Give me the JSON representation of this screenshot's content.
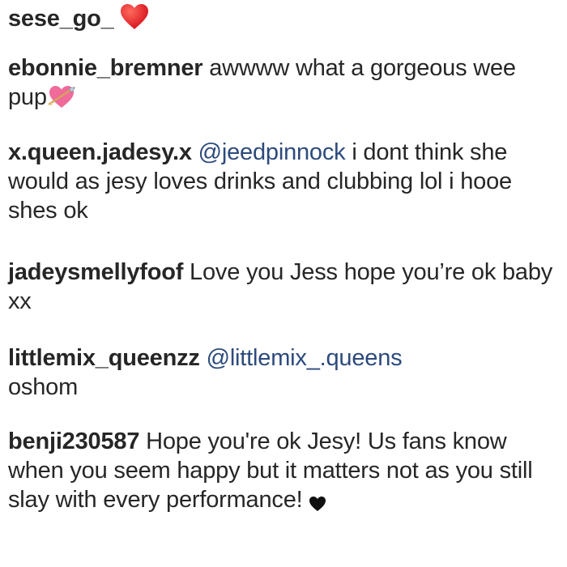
{
  "comments": [
    {
      "username": "sese_go_",
      "text": "",
      "emoji": "red-heart-icon"
    },
    {
      "username": "ebonnie_bremner",
      "text": "awwww what a gorgeous wee pup",
      "emoji": "heart-with-arrow-icon"
    },
    {
      "username": "x.queen.jadesy.x",
      "mention": "@jeedpinnock",
      "text": "i dont think she would as jesy loves drinks and clubbing lol i hooe shes ok"
    },
    {
      "username": "jadeysmellyfoof",
      "text": "Love you Jess hope you’re ok baby xx"
    },
    {
      "username": "littlemix_queenzz",
      "mention": "@littlemix_.queens",
      "text": "oshom"
    },
    {
      "username": "benji230587",
      "text": "Hope you're ok Jesy! Us fans know when you seem happy but it matters not as you still slay with every performance!",
      "emoji": "black-heart-icon"
    }
  ],
  "colors": {
    "text": "#262626",
    "mention": "#2c4a7c",
    "red_heart": "#e0282e",
    "pink_heart": "#f06a9a",
    "black_heart": "#111111"
  }
}
